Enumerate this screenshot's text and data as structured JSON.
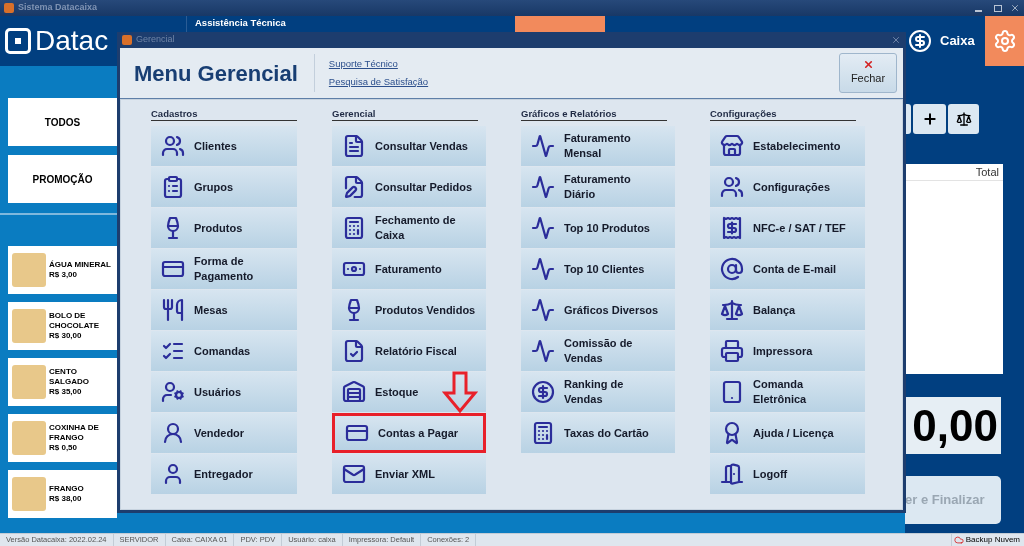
{
  "app_title": "Sistema Datacaixa",
  "logo_text": "Datac",
  "header_link": "Assistência Técnica",
  "cashier_label": "Caixa",
  "categories": [
    {
      "label": "TODOS"
    },
    {
      "label": "PROMOÇÃO"
    }
  ],
  "products": [
    {
      "name": "ÁGUA MINERAL",
      "price": "R$ 3,00"
    },
    {
      "name": "BOLO DE CHOCOLATE",
      "price": "R$ 30,00"
    },
    {
      "name": "CENTO SALGADO",
      "price": "R$ 35,00"
    },
    {
      "name": "COXINHA DE FRANGO",
      "price": "R$ 0,50"
    },
    {
      "name": "FRANGO",
      "price": "R$ 38,00"
    }
  ],
  "order_table": {
    "columns": [
      "Total"
    ]
  },
  "total": "0,00",
  "finalize_button": "er e Finalizar",
  "dialog": {
    "title": "Gerencial",
    "heading": "Menu Gerencial",
    "links": [
      "Suporte Técnico",
      "Pesquisa de Satisfação"
    ],
    "close_button": "Fechar",
    "columns": [
      {
        "heading": "Cadastros",
        "items": [
          {
            "label": "Clientes",
            "highlighted": false
          },
          {
            "label": "Grupos",
            "highlighted": false
          },
          {
            "label": "Produtos",
            "highlighted": false
          },
          {
            "label": "Forma de\nPagamento",
            "highlighted": false
          },
          {
            "label": "Mesas",
            "highlighted": false
          },
          {
            "label": "Comandas",
            "highlighted": false
          },
          {
            "label": "Usuários",
            "highlighted": false
          },
          {
            "label": "Vendedor",
            "highlighted": false
          },
          {
            "label": "Entregador",
            "highlighted": false
          }
        ]
      },
      {
        "heading": "Gerencial",
        "items": [
          {
            "label": "Consultar Vendas",
            "highlighted": false
          },
          {
            "label": "Consultar Pedidos",
            "highlighted": false
          },
          {
            "label": "Fechamento de\nCaixa",
            "highlighted": false
          },
          {
            "label": "Faturamento",
            "highlighted": false
          },
          {
            "label": "Produtos Vendidos",
            "highlighted": false
          },
          {
            "label": "Relatório Fiscal",
            "highlighted": false
          },
          {
            "label": "Estoque",
            "highlighted": false
          },
          {
            "label": "Contas a Pagar",
            "highlighted": true
          },
          {
            "label": "Enviar XML",
            "highlighted": false
          }
        ]
      },
      {
        "heading": "Gráficos e Relatórios",
        "items": [
          {
            "label": "Faturamento\nMensal",
            "highlighted": false
          },
          {
            "label": "Faturamento\nDiário",
            "highlighted": false
          },
          {
            "label": "Top 10 Produtos",
            "highlighted": false
          },
          {
            "label": "Top 10 Clientes",
            "highlighted": false
          },
          {
            "label": "Gráficos Diversos",
            "highlighted": false
          },
          {
            "label": "Comissão de\nVendas",
            "highlighted": false
          },
          {
            "label": "Ranking de\nVendas",
            "highlighted": false
          },
          {
            "label": "Taxas do Cartão",
            "highlighted": false
          }
        ]
      },
      {
        "heading": "Configurações",
        "items": [
          {
            "label": "Estabelecimento",
            "highlighted": false
          },
          {
            "label": "Configurações",
            "highlighted": false
          },
          {
            "label": "NFC-e / SAT / TEF",
            "highlighted": false
          },
          {
            "label": "Conta de E-mail",
            "highlighted": false
          },
          {
            "label": "Balança",
            "highlighted": false
          },
          {
            "label": "Impressora",
            "highlighted": false
          },
          {
            "label": "Comanda\nEletrônica",
            "highlighted": false
          },
          {
            "label": "Ajuda / Licença",
            "highlighted": false
          },
          {
            "label": "Logoff",
            "highlighted": false
          }
        ]
      }
    ]
  },
  "status_bar": [
    "Versão Datacaixa: 2022.02.24",
    "SERVIDOR",
    "Caixa: CAIXA 01",
    "PDV: PDV",
    "Usuário: caixa",
    "Impressora: Default",
    "Conexões: 2"
  ],
  "backup_label": "Backup Nuvem"
}
